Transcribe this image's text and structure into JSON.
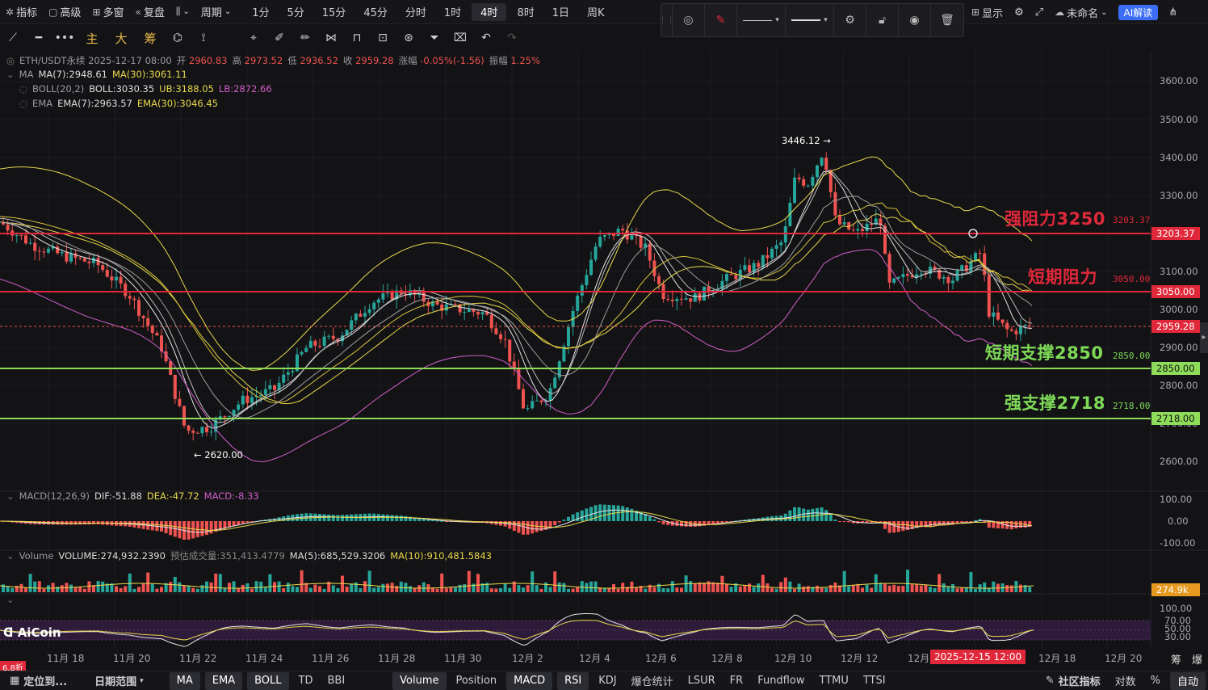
{
  "top_menu": {
    "indicators": "指标",
    "advanced": "高级",
    "multi_window": "多窗",
    "replay": "复盘",
    "period": "周期",
    "timeframes": [
      "1分",
      "5分",
      "15分",
      "45分",
      "分时",
      "1时",
      "4时",
      "8时",
      "1日",
      "周K"
    ],
    "active_timeframe": "4时",
    "display": "显示",
    "user": "未命名",
    "ai_button": "AI解读"
  },
  "toolbar2": {
    "main": "主",
    "big": "大",
    "chips": "筹"
  },
  "legend": {
    "symbol_line": "ETH/USDT永续  2025-12-17 08:00",
    "open_label": "开",
    "open": "2960.83",
    "high_label": "高",
    "high": "2973.52",
    "low_label": "低",
    "low": "2936.52",
    "close_label": "收",
    "close": "2959.28",
    "change_label": "涨幅",
    "change": "-0.05%(-1.56)",
    "amp_label": "振幅",
    "amp": "1.25%",
    "ma_name": "MA",
    "ma7": "MA(7):2948.61",
    "ma30": "MA(30):3061.11",
    "boll_name": "BOLL(20,2)",
    "boll": "BOLL:3030.35",
    "ub": "UB:3188.05",
    "lb": "LB:2872.66",
    "ema_name": "EMA",
    "ema7": "EMA(7):2963.57",
    "ema30": "EMA(30):3046.45",
    "macd_name": "MACD(12,26,9)",
    "dif": "DIF:-51.88",
    "dea": "DEA:-47.72",
    "macd": "MACD:-8.33",
    "vol_name": "Volume",
    "vol": "VOLUME:274,932.2390",
    "vol_est": "预估成交量:351,413.4779",
    "vol_ma5": "MA(5):685,529.3206",
    "vol_ma10": "MA(10):910,481.5843"
  },
  "price_axis": [
    "3600.00",
    "3500.00",
    "3400.00",
    "3300.00",
    "3100.00",
    "3000.00",
    "2900.00",
    "2800.00",
    "2700.00",
    "2600.00"
  ],
  "price_tags": {
    "resist_strong": "3203.37",
    "resist_short": "3050.00",
    "current": "2959.28",
    "support_short": "2850.00",
    "support_strong": "2718.00"
  },
  "annotations": {
    "strong_resist": "强阻力3250",
    "strong_resist_val": "3203.37",
    "short_resist": "短期阻力",
    "short_resist_val": "3050.00",
    "short_support": "短期支撑2850",
    "short_support_val": "2850.00",
    "strong_support": "强支撑2718",
    "strong_support_val": "2718.00",
    "high_mark": "3446.12 →",
    "low_mark": "← 2620.00"
  },
  "macd_axis": [
    "100.00",
    "0.00",
    "-100.00"
  ],
  "vol_tag": "274.9k",
  "rsi_axis": [
    "100.00",
    "70.00",
    "50.00",
    "30.00"
  ],
  "x_axis": [
    "11月 18",
    "11月 20",
    "11月 22",
    "11月 24",
    "11月 26",
    "11月 28",
    "11月 30",
    "12月 2",
    "12月 4",
    "12月 6",
    "12月 8",
    "12月 10",
    "12月 12",
    "12月",
    "12月 18",
    "12月 20"
  ],
  "x_highlight": "2025-12-15 12:00",
  "x_right": [
    "筹",
    "爆"
  ],
  "brand": "AiCoin",
  "discount": "6.8折",
  "bottom_bar": {
    "locate": "定位到...",
    "range": "日期范围",
    "items": [
      "MA",
      "EMA",
      "BOLL",
      "TD",
      "BBI",
      "Volume",
      "Position",
      "MACD",
      "RSI",
      "KDJ",
      "爆仓统计",
      "LSUR",
      "FR",
      "Fundflow",
      "TTMU",
      "TTSI"
    ],
    "selected": [
      "MA",
      "EMA",
      "BOLL",
      "Volume",
      "MACD",
      "RSI"
    ],
    "community": "社区指标",
    "log": "对数",
    "pct": "%",
    "auto": "自动"
  },
  "colors": {
    "up": "#26a69a",
    "down": "#ef5350",
    "resist": "#e0283a",
    "support": "#7ed957",
    "bg": "#131316"
  }
}
